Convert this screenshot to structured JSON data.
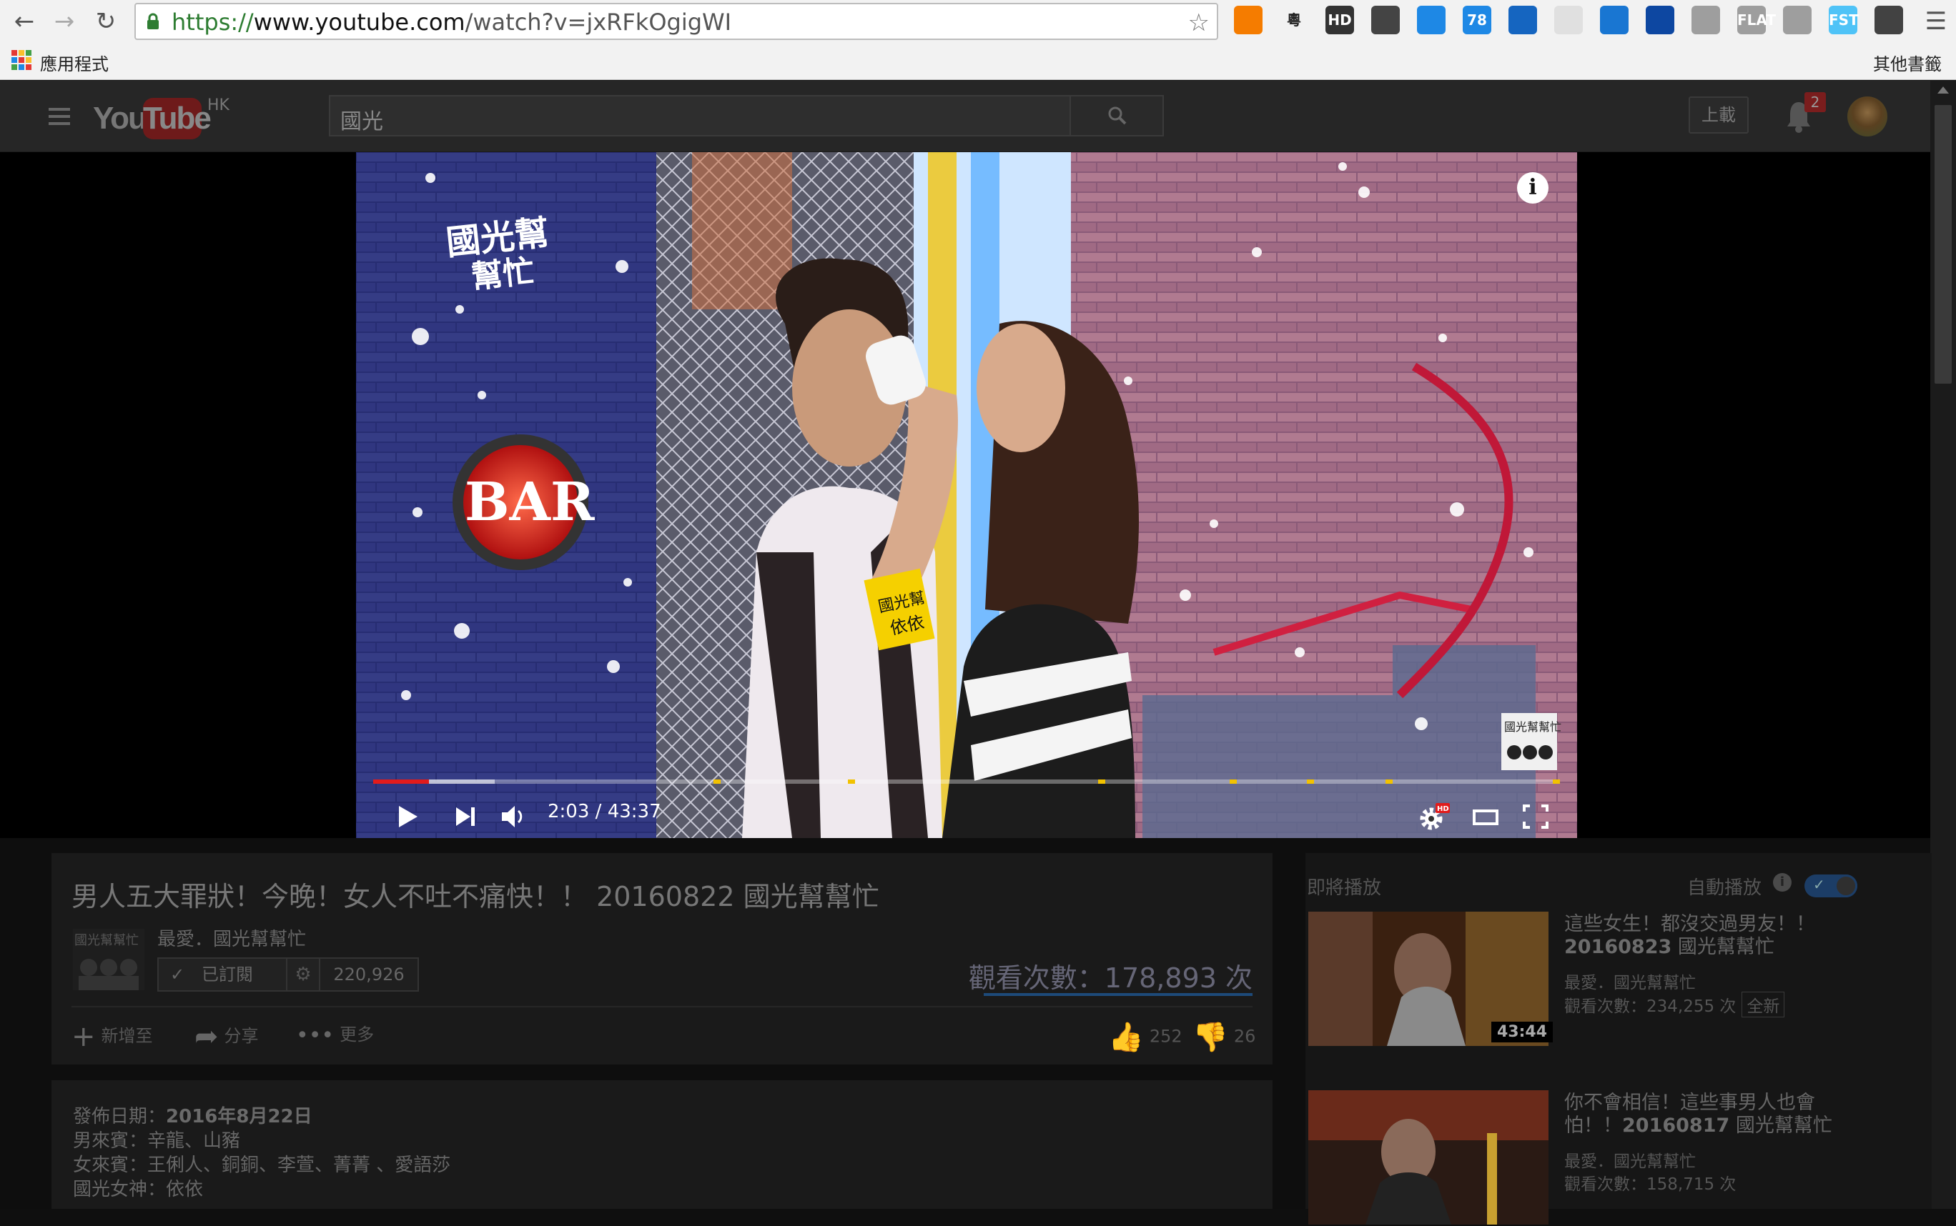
{
  "browser": {
    "url_scheme": "https://",
    "url_host": "www.youtube.com",
    "url_path": "/watch?v=jxRFkOgigWI",
    "bookmarks_apps": "應用程式",
    "bookmarks_other": "其他書籤",
    "extensions": [
      {
        "label": "",
        "color": "#f57c00"
      },
      {
        "label": "粵",
        "color": "#f2f2f2"
      },
      {
        "label": "HD",
        "color": "#333333"
      },
      {
        "label": "",
        "color": "#444444"
      },
      {
        "label": "",
        "color": "#1e88e5"
      },
      {
        "label": "78",
        "color": "#1e88e5"
      },
      {
        "label": "",
        "color": "#1565c0"
      },
      {
        "label": "",
        "color": "#e0e0e0"
      },
      {
        "label": "",
        "color": "#1976d2"
      },
      {
        "label": "",
        "color": "#0d47a1"
      },
      {
        "label": "",
        "color": "#9e9e9e"
      },
      {
        "label": "FLAT",
        "color": "#9e9e9e"
      },
      {
        "label": "",
        "color": "#9e9e9e"
      },
      {
        "label": "FST",
        "color": "#4fc3f7"
      },
      {
        "label": "",
        "color": "#424242"
      }
    ]
  },
  "youtube": {
    "logo_you": "You",
    "logo_tube": "Tube",
    "logo_region": "HK",
    "search_value": "國光",
    "upload_label": "上載",
    "notifications_count": "2"
  },
  "player": {
    "time_current": "2:03",
    "time_separator": " / ",
    "time_total": "43:37",
    "progress_played_fraction": 0.047,
    "accent": "#e21b1b"
  },
  "video": {
    "title": "男人五大罪狀！今晚！女人不吐不痛快！！ 20160822 國光幫幫忙",
    "channel": "最愛．國光幫幫忙",
    "subscribe_label": "已訂閱",
    "subscriber_count": "220,926",
    "views": "觀看次數：178,893 次",
    "actions": {
      "add": "新增至",
      "share": "分享",
      "more": "更多"
    },
    "likes": "252",
    "dislikes": "26"
  },
  "description": {
    "published_label": "發佈日期：",
    "published_date": "2016年8月22日",
    "male_guests": "男來賓：辛龍、山豬",
    "female_guests": "女來賓：王俐人、銅銅、李萱、菁菁 、愛語莎",
    "goddess": "國光女神：依依"
  },
  "sidebar": {
    "up_next": "即將播放",
    "autoplay": "自動播放",
    "cards": [
      {
        "title": "這些女生！都沒交過男友！！",
        "title_bold": "20160823",
        "title_rest": " 國光幫幫忙",
        "channel": "最愛．國光幫幫忙",
        "views": "觀看次數：234,255 次",
        "badge": "全新",
        "duration": "43:44"
      },
      {
        "title": "你不會相信！這些事男人也會怕！！",
        "title_bold": "20160817",
        "title_rest": " 國光幫幫忙",
        "channel": "最愛．國光幫幫忙",
        "views": "觀看次數：158,715 次",
        "badge": "",
        "duration": ""
      }
    ]
  }
}
